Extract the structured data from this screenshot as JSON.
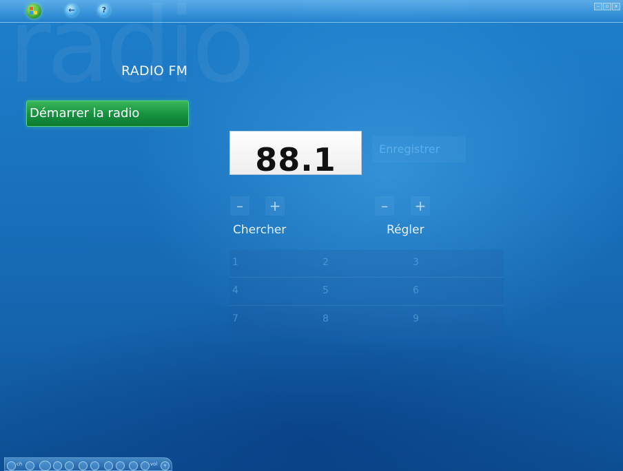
{
  "window": {
    "background_word": "radio",
    "controls": {
      "minimize": "–",
      "restore": "▫",
      "close": "x"
    }
  },
  "header": {
    "start_icon": "windows-flag-icon",
    "back_icon": "back-arrow-icon",
    "help_icon": "help-icon",
    "help_glyph": "?",
    "back_glyph": "←"
  },
  "page": {
    "title": "RADIO FM"
  },
  "menu": {
    "items": [
      {
        "label": "Démarrer la radio",
        "selected": true
      }
    ]
  },
  "tuner": {
    "frequency": "88.1",
    "record_label": "Enregistrer",
    "seek": {
      "label": "Chercher",
      "minus": "–",
      "plus": "+"
    },
    "tune": {
      "label": "Régler",
      "minus": "–",
      "plus": "+"
    }
  },
  "presets": [
    "1",
    "2",
    "3",
    "4",
    "5",
    "6",
    "7",
    "8",
    "9"
  ],
  "transport": {
    "ch_label": "ch",
    "vol_label": "vol",
    "plus_glyph": "+"
  },
  "colors": {
    "background": "#1a73bf",
    "accent_green": "#179341",
    "display_bg": "#ffffff"
  }
}
